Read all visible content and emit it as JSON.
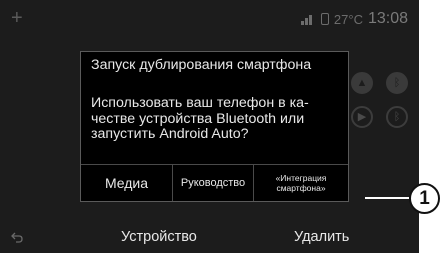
{
  "status": {
    "plus": "+",
    "temperature": "27°C",
    "time": "13:08"
  },
  "dialog": {
    "title": "Запуск дублирования смартфона",
    "message": "Использовать ваш телефон в ка-\nчестве устройства Bluetooth или\nзапустить Android Auto?",
    "buttons": {
      "media": "Медиа",
      "guide": "Руководство",
      "integration": "«Интеграция\nсмартфона»"
    }
  },
  "bottom_bar": {
    "devices": "Устройство",
    "delete": "Удалить"
  },
  "callout": "1",
  "colors": {
    "screen_bg": "#1c1c1c",
    "dialog_bg": "#000000",
    "text": "#e8e8e8"
  }
}
